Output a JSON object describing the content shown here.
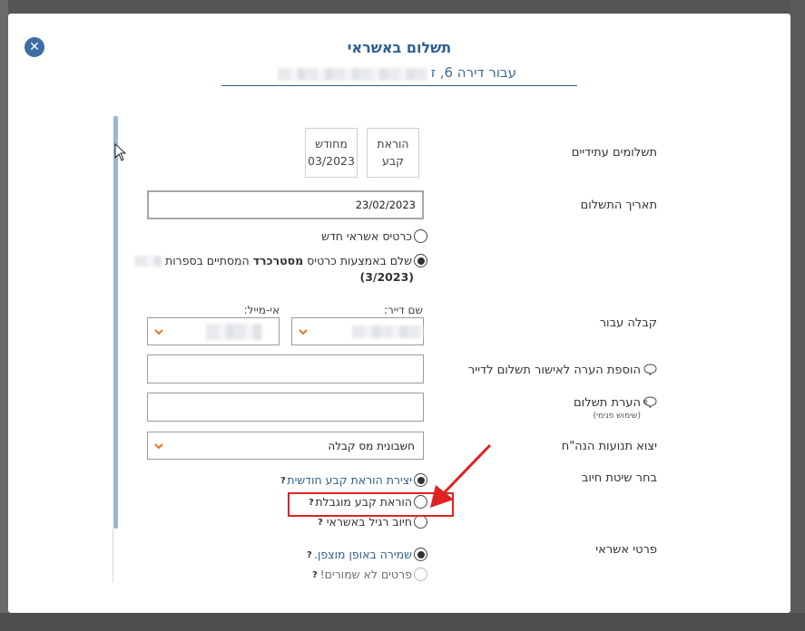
{
  "dialog": {
    "title": "תשלום באשראי",
    "subtitle": "עבור דירה 6, ז"
  },
  "future_payments": {
    "label": "תשלומים עתידיים",
    "tiles": [
      {
        "line1": "הוראת",
        "line2": "קבע"
      },
      {
        "line1": "מחודש",
        "line2": "03/2023"
      }
    ]
  },
  "payment_date": {
    "label": "תאריך התשלום",
    "value": "23/02/2023"
  },
  "card_options": {
    "new_card": "כרטיס אשראי חדש",
    "existing_prefix": "שלם באמצעות כרטיס",
    "existing_brand": "מסטרכרד",
    "existing_suffix": "המסתיים בספרות",
    "existing_expiry": "(3/2023)"
  },
  "receipt": {
    "label": "קבלה עבור",
    "tenant_label": "שם דייר:",
    "email_label": "אי-מייל:"
  },
  "tenant_note": {
    "label": "הוספת הערה לאישור תשלום לדייר",
    "value": ""
  },
  "payment_note": {
    "label": "הערת תשלום",
    "sublabel": "(שימוש פנימי)",
    "value": ""
  },
  "export": {
    "label": "יצוא תנועות הנה\"ח",
    "selected": "חשבונית מס קבלה"
  },
  "charge_method": {
    "label": "בחר שיטת חיוב",
    "options": [
      {
        "text": "יצירת הוראת קבע חודשית",
        "help": "?",
        "selected": true
      },
      {
        "text": "הוראת קבע מוגבלת",
        "help": "?",
        "selected": false
      },
      {
        "text": "חיוב רגיל באשראי",
        "help": "?",
        "selected": false
      }
    ]
  },
  "card_details": {
    "label": "פרטי אשראי",
    "options": [
      {
        "text": "שמירה באופן מוצפן.",
        "help": "?",
        "selected": true
      },
      {
        "text": "פרטים לא שמורים!",
        "help": "?",
        "selected": false
      }
    ]
  },
  "colors": {
    "accent": "#2e5f8f",
    "highlight": "#e02222",
    "chevron": "#e8731f"
  }
}
